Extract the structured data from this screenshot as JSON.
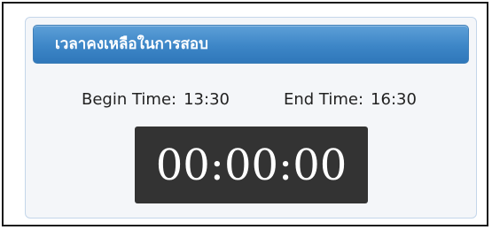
{
  "panel": {
    "title": "เวลาคงเหลือในการสอบ"
  },
  "exam_time": {
    "begin_label": "Begin Time:",
    "begin_value": "13:30",
    "end_label": "End Time:",
    "end_value": "16:30"
  },
  "timer": {
    "remaining": "00:00:00"
  },
  "colors": {
    "header_blue": "#3d86c7",
    "timer_background": "#333333",
    "timer_text": "#ffffff"
  }
}
